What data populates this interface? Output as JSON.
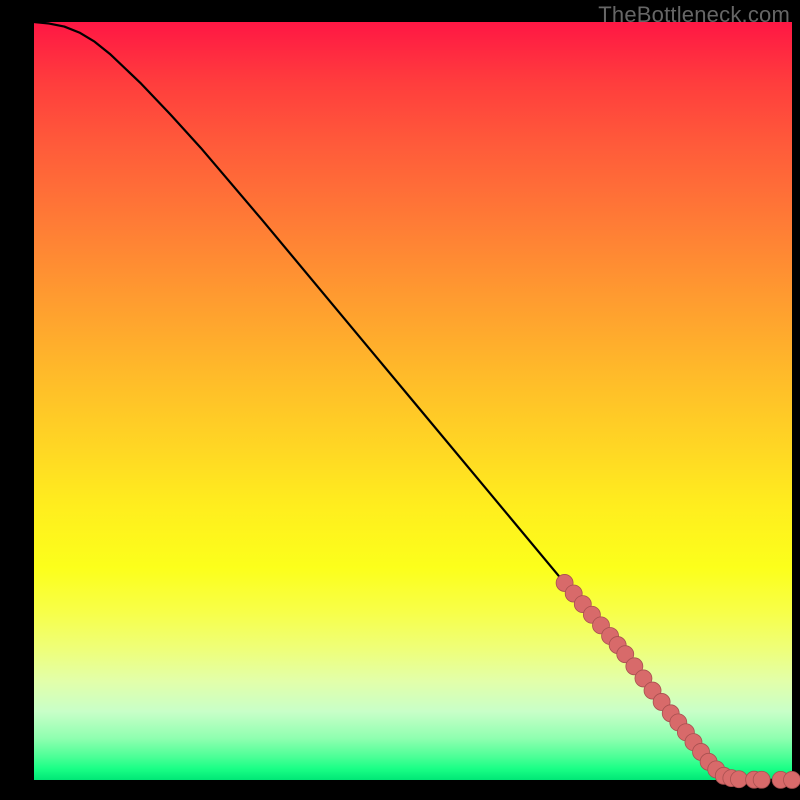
{
  "watermark": "TheBottleneck.com",
  "colors": {
    "pink_point": "#d86a6a",
    "pink_point_stroke": "#a85050",
    "curve": "#000000",
    "background": "#000000"
  },
  "chart_data": {
    "type": "line",
    "title": "",
    "xlabel": "",
    "ylabel": "",
    "xlim": [
      0,
      100
    ],
    "ylim": [
      0,
      100
    ],
    "series": [
      {
        "name": "curve",
        "x": [
          0,
          2,
          4,
          6,
          8,
          10,
          14,
          18,
          22,
          30,
          40,
          50,
          60,
          70,
          78,
          84,
          88,
          90,
          91,
          92.5,
          94,
          96,
          98,
          100
        ],
        "y": [
          100,
          99.8,
          99.4,
          98.6,
          97.4,
          95.8,
          92.0,
          87.8,
          83.4,
          74.0,
          62.0,
          50.0,
          38.0,
          26.0,
          16.0,
          8.5,
          3.5,
          1.4,
          0.55,
          0.18,
          0.07,
          0.03,
          0.015,
          0.01
        ]
      }
    ],
    "points": [
      {
        "x": 70.0,
        "y": 26.0
      },
      {
        "x": 71.2,
        "y": 24.6
      },
      {
        "x": 72.4,
        "y": 23.2
      },
      {
        "x": 73.6,
        "y": 21.8
      },
      {
        "x": 74.8,
        "y": 20.4
      },
      {
        "x": 76.0,
        "y": 19.0
      },
      {
        "x": 77.0,
        "y": 17.8
      },
      {
        "x": 78.0,
        "y": 16.6
      },
      {
        "x": 79.2,
        "y": 15.0
      },
      {
        "x": 80.4,
        "y": 13.4
      },
      {
        "x": 81.6,
        "y": 11.8
      },
      {
        "x": 82.8,
        "y": 10.3
      },
      {
        "x": 84.0,
        "y": 8.8
      },
      {
        "x": 85.0,
        "y": 7.6
      },
      {
        "x": 86.0,
        "y": 6.3
      },
      {
        "x": 87.0,
        "y": 5.0
      },
      {
        "x": 88.0,
        "y": 3.7
      },
      {
        "x": 89.0,
        "y": 2.4
      },
      {
        "x": 90.0,
        "y": 1.4
      },
      {
        "x": 91.0,
        "y": 0.55
      },
      {
        "x": 92.0,
        "y": 0.25
      },
      {
        "x": 93.0,
        "y": 0.1
      },
      {
        "x": 95.0,
        "y": 0.04
      },
      {
        "x": 96.0,
        "y": 0.03
      },
      {
        "x": 98.5,
        "y": 0.015
      },
      {
        "x": 100.0,
        "y": 0.01
      }
    ],
    "point_radius": 8.5
  }
}
